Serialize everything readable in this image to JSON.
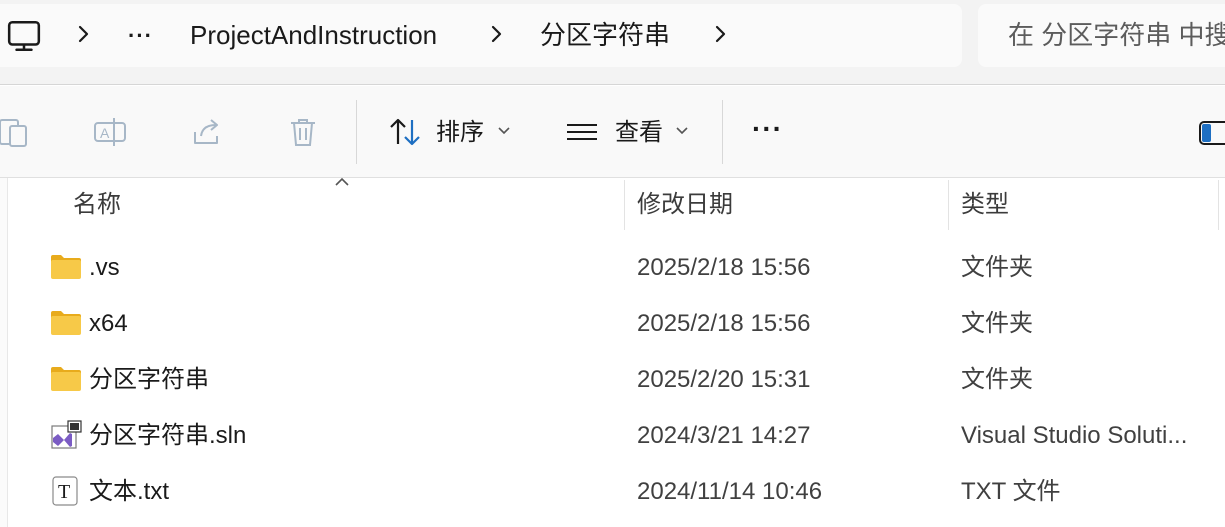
{
  "address_bar": {
    "breadcrumbs": [
      "ProjectAndInstruction",
      "分区字符串"
    ],
    "overflow_label": "···",
    "computer_icon": "computer-icon"
  },
  "search": {
    "placeholder": "在 分区字符串 中搜索"
  },
  "toolbar": {
    "sort_label": "排序",
    "view_label": "查看",
    "more_label": "···",
    "icons": [
      "copy-icon",
      "rename-icon",
      "share-icon",
      "delete-icon",
      "sort-icon",
      "view-icon",
      "details-pane-icon"
    ]
  },
  "columns": {
    "name": "名称",
    "date_modified": "修改日期",
    "type": "类型"
  },
  "files": [
    {
      "name": ".vs",
      "date": "2025/2/18 15:56",
      "type": "文件夹",
      "icon": "folder-icon"
    },
    {
      "name": "x64",
      "date": "2025/2/18 15:56",
      "type": "文件夹",
      "icon": "folder-icon"
    },
    {
      "name": "分区字符串",
      "date": "2025/2/20 15:31",
      "type": "文件夹",
      "icon": "folder-icon"
    },
    {
      "name": "分区字符串.sln",
      "date": "2024/3/21 14:27",
      "type": "Visual Studio Soluti...",
      "icon": "visual-studio-solution-icon"
    },
    {
      "name": "文本.txt",
      "date": "2024/11/14 10:46",
      "type": "TXT 文件",
      "icon": "text-file-icon"
    }
  ],
  "colors": {
    "folder": "#f7c948",
    "folder_dark": "#e8ab1c",
    "vs_purple": "#7b5cc4"
  }
}
